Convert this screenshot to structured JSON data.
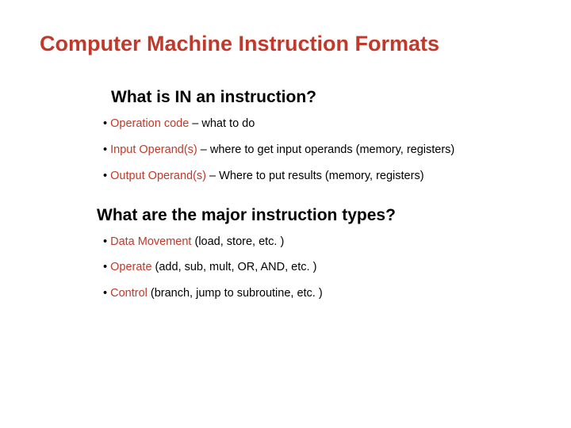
{
  "title": "Computer Machine Instruction Formats",
  "section1": {
    "heading": "What is IN an instruction?",
    "items": [
      {
        "term": "Operation code",
        "desc": " – what to do"
      },
      {
        "term": "Input Operand(s)",
        "desc": " – where to get input operands (memory, registers)"
      },
      {
        "term": "Output Operand(s)",
        "desc": " – Where to put results (memory, registers)"
      }
    ]
  },
  "section2": {
    "heading": "What are the major instruction types?",
    "items": [
      {
        "term": "Data Movement",
        "desc": " (load, store, etc. )"
      },
      {
        "term": "Operate",
        "desc": " (add, sub, mult, OR, AND, etc. )"
      },
      {
        "term": "Control",
        "desc": " (branch, jump to subroutine, etc. )"
      }
    ]
  }
}
